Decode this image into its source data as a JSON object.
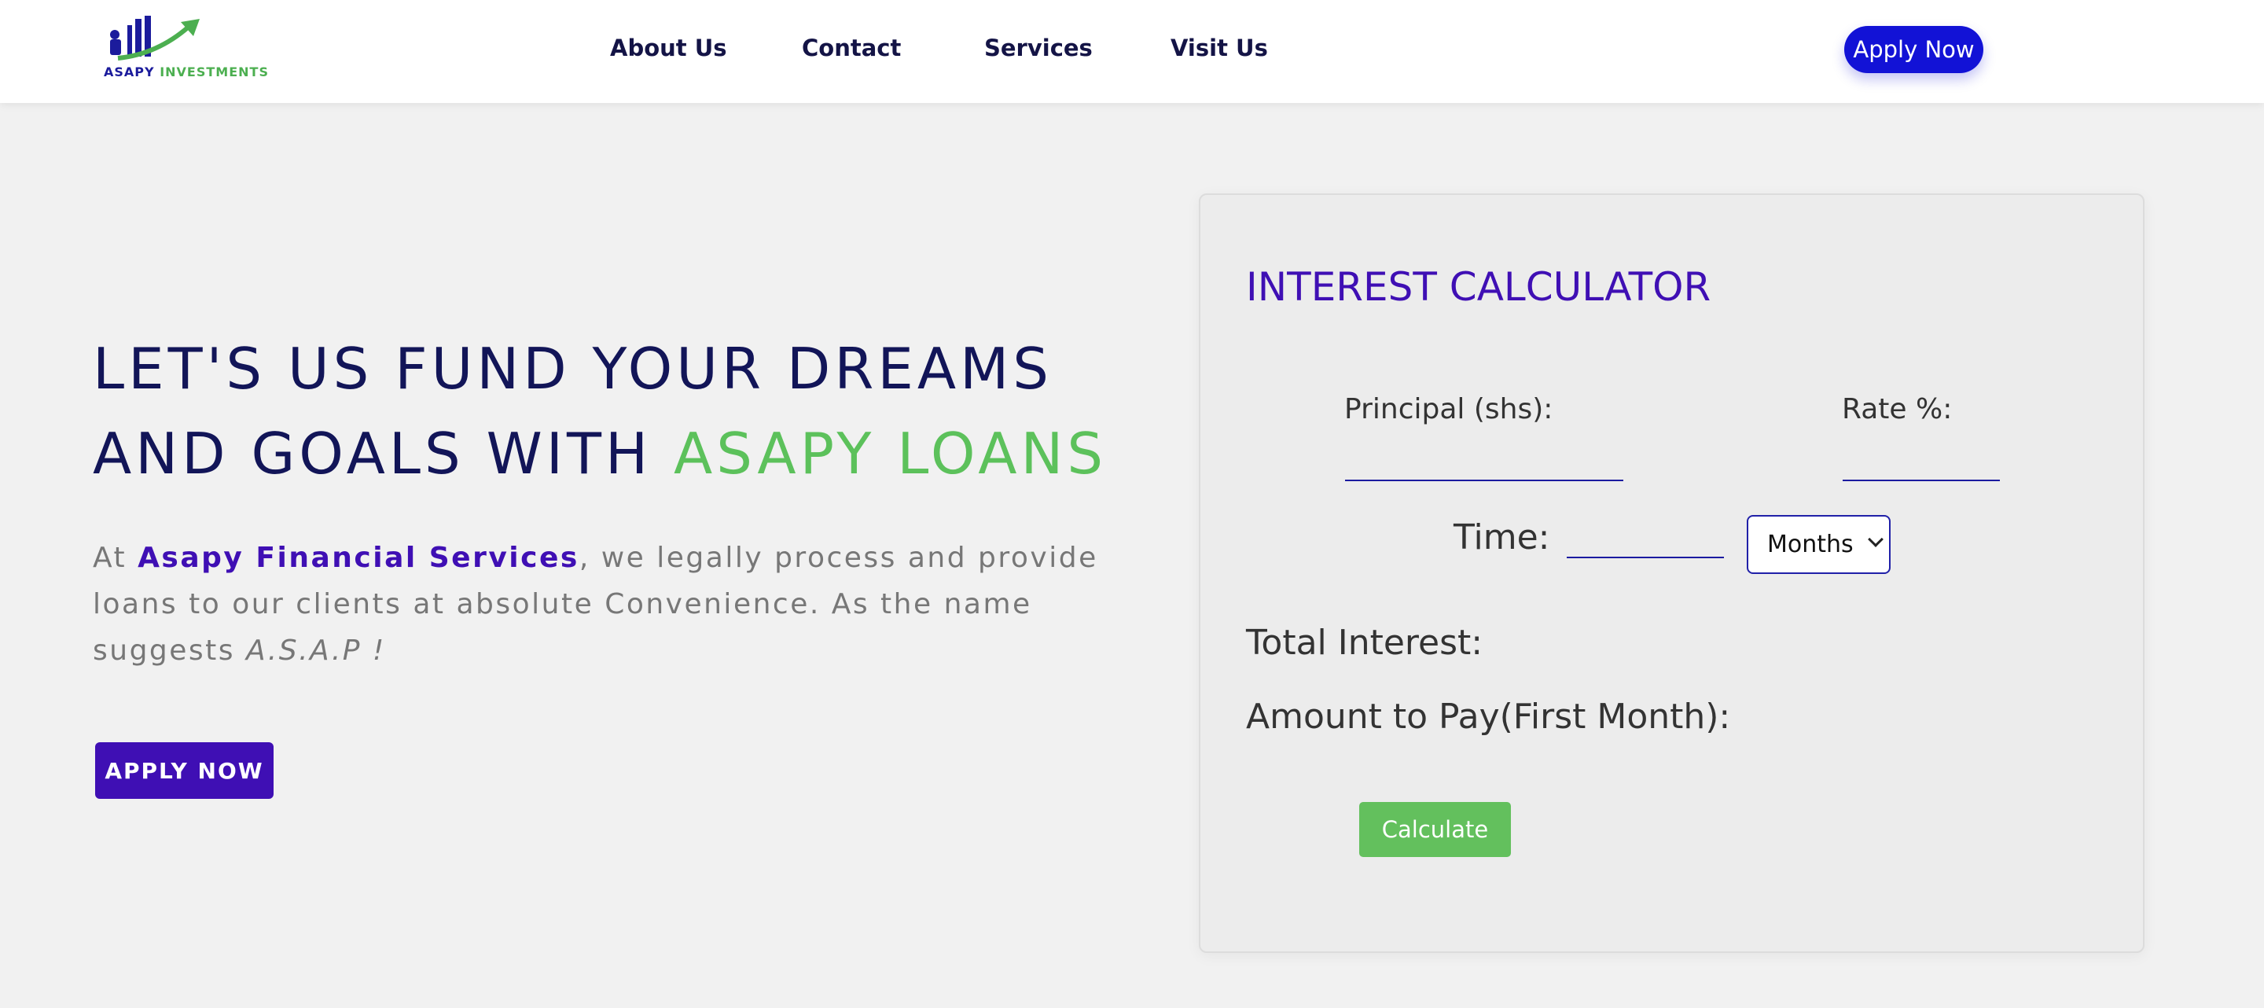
{
  "header": {
    "logo_line1": "ASAPY",
    "logo_line2": "INVESTMENTS",
    "nav": [
      "About Us",
      "Contact",
      "Services",
      "Visit Us"
    ],
    "apply_label": "Apply Now"
  },
  "hero": {
    "title_part1": "LET'S US FUND YOUR DREAMS AND GOALS WITH ",
    "title_accent": "ASAPY LOANS",
    "text_prefix": "At ",
    "text_brand": "Asapy Financial Services",
    "text_body": ", we legally process and provide loans to our clients at absolute Convenience. As the name suggests ",
    "text_asap": "A.S.A.P !",
    "apply_label": "APPLY NOW"
  },
  "calculator": {
    "title": "INTEREST CALCULATOR",
    "principal_label": "Principal (shs):",
    "principal_value": "",
    "rate_label": "Rate %:",
    "rate_value": "",
    "time_label": "Time:",
    "time_value": "",
    "time_unit": "Months",
    "total_interest_label": "Total Interest:",
    "amount_label": "Amount to Pay(First Month):",
    "calculate_label": "Calculate"
  },
  "colors": {
    "primary_blue": "#1212d6",
    "brand_purple": "#3f0fb4",
    "accent_green": "#5cc15b",
    "heading_navy": "#121558"
  }
}
